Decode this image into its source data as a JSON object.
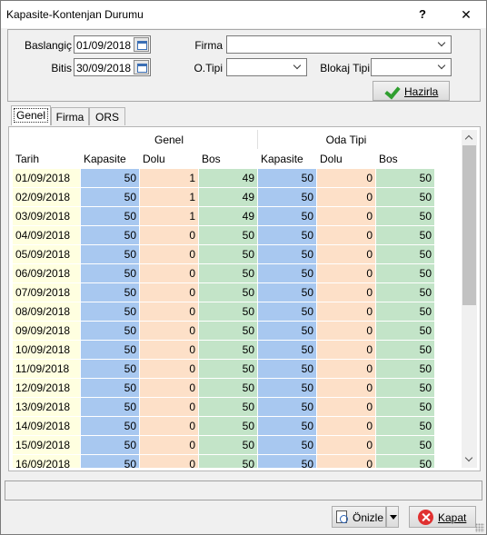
{
  "window": {
    "title": "Kapasite-Kontenjan Durumu",
    "help_glyph": "?",
    "close_glyph": "✕"
  },
  "filters": {
    "baslangic_label": "Baslangiç",
    "baslangic_value": "01/09/2018",
    "bitis_label": "Bitis",
    "bitis_value": "30/09/2018",
    "firma_label": "Firma",
    "firma_value": "",
    "otipi_label": "O.Tipi",
    "otipi_value": "",
    "blokaj_label": "Blokaj Tipi",
    "blokaj_value": "",
    "hazirla_label": "Hazirla"
  },
  "tabs": [
    {
      "label": "Genel",
      "active": true
    },
    {
      "label": "Firma",
      "active": false
    },
    {
      "label": "ORS",
      "active": false
    }
  ],
  "grid": {
    "group_headers": {
      "genel": "Genel",
      "oda_tipi": "Oda Tipi"
    },
    "columns": [
      "Tarih",
      "Kapasite",
      "Dolu",
      "Bos",
      "Kapasite",
      "Dolu",
      "Bos"
    ],
    "rows": [
      [
        "01/09/2018",
        "50",
        "1",
        "49",
        "50",
        "0",
        "50"
      ],
      [
        "02/09/2018",
        "50",
        "1",
        "49",
        "50",
        "0",
        "50"
      ],
      [
        "03/09/2018",
        "50",
        "1",
        "49",
        "50",
        "0",
        "50"
      ],
      [
        "04/09/2018",
        "50",
        "0",
        "50",
        "50",
        "0",
        "50"
      ],
      [
        "05/09/2018",
        "50",
        "0",
        "50",
        "50",
        "0",
        "50"
      ],
      [
        "06/09/2018",
        "50",
        "0",
        "50",
        "50",
        "0",
        "50"
      ],
      [
        "07/09/2018",
        "50",
        "0",
        "50",
        "50",
        "0",
        "50"
      ],
      [
        "08/09/2018",
        "50",
        "0",
        "50",
        "50",
        "0",
        "50"
      ],
      [
        "09/09/2018",
        "50",
        "0",
        "50",
        "50",
        "0",
        "50"
      ],
      [
        "10/09/2018",
        "50",
        "0",
        "50",
        "50",
        "0",
        "50"
      ],
      [
        "11/09/2018",
        "50",
        "0",
        "50",
        "50",
        "0",
        "50"
      ],
      [
        "12/09/2018",
        "50",
        "0",
        "50",
        "50",
        "0",
        "50"
      ],
      [
        "13/09/2018",
        "50",
        "0",
        "50",
        "50",
        "0",
        "50"
      ],
      [
        "14/09/2018",
        "50",
        "0",
        "50",
        "50",
        "0",
        "50"
      ],
      [
        "15/09/2018",
        "50",
        "0",
        "50",
        "50",
        "0",
        "50"
      ],
      [
        "16/09/2018",
        "50",
        "0",
        "50",
        "50",
        "0",
        "50"
      ]
    ]
  },
  "footer": {
    "onizle_label": "Önizle",
    "kapat_label": "Kapat"
  },
  "colors": {
    "date_bg": "#ffffe0",
    "kapasite_bg": "#a8c8f0",
    "dolu_bg": "#fde0c8",
    "bos_bg": "#c3e4c8"
  },
  "icons": {
    "calendar": "calendar-icon",
    "dropdown": "chevron-down-icon",
    "hazirla": "checkmark-icon",
    "onizle": "print-preview-icon",
    "kapat": "close-circle-icon"
  }
}
